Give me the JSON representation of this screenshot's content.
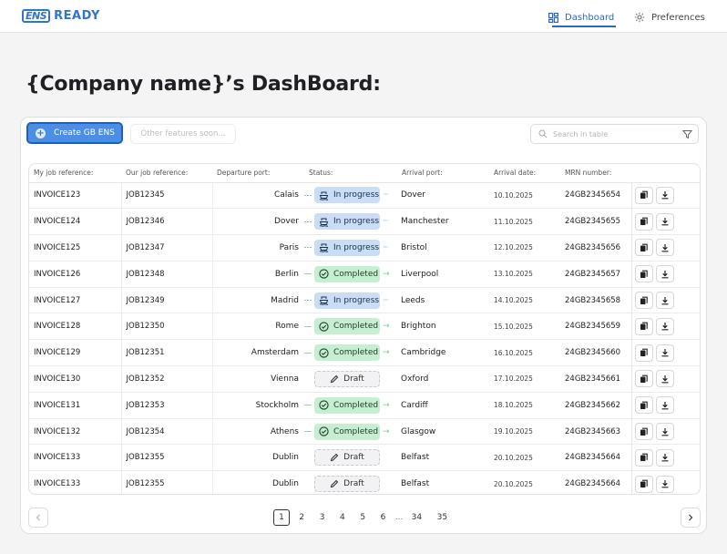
{
  "brand": {
    "mark": "ENS",
    "name": "READY"
  },
  "nav": {
    "dashboard": "Dashboard",
    "preferences": "Preferences"
  },
  "page_title": "{Company name}’s DashBoard:",
  "toolbar": {
    "create_label": "Create GB ENS",
    "soon_label": "Other features soon...",
    "search_placeholder": "Search in table"
  },
  "table": {
    "columns": [
      "My job reference:",
      "Our job reference:",
      "Departure port:",
      "Status:",
      "Arrival port:",
      "Arrival date:",
      "MRN number:"
    ],
    "rows": [
      {
        "my_ref": "INVOICE123",
        "our_ref": "JOB12345",
        "departure": "Calais",
        "status": "In progress",
        "status_type": "progress",
        "arrival": "Dover",
        "date": "10.10.2025",
        "mrn": "24GB2345654"
      },
      {
        "my_ref": "INVOICE124",
        "our_ref": "JOB12346",
        "departure": "Dover",
        "status": "In progress",
        "status_type": "progress",
        "arrival": "Manchester",
        "date": "11.10.2025",
        "mrn": "24GB2345655"
      },
      {
        "my_ref": "INVOICE125",
        "our_ref": "JOB12347",
        "departure": "Paris",
        "status": "In progress",
        "status_type": "progress",
        "arrival": "Bristol",
        "date": "12.10.2025",
        "mrn": "24GB2345656"
      },
      {
        "my_ref": "INVOICE126",
        "our_ref": "JOB12348",
        "departure": "Berlin",
        "status": "Completed",
        "status_type": "completed",
        "arrival": "Liverpool",
        "date": "13.10.2025",
        "mrn": "24GB2345657"
      },
      {
        "my_ref": "INVOICE127",
        "our_ref": "JOB12349",
        "departure": "Madrid",
        "status": "In progress",
        "status_type": "progress",
        "arrival": "Leeds",
        "date": "14.10.2025",
        "mrn": "24GB2345658"
      },
      {
        "my_ref": "INVOICE128",
        "our_ref": "JOB12350",
        "departure": "Rome",
        "status": "Completed",
        "status_type": "completed",
        "arrival": "Brighton",
        "date": "15.10.2025",
        "mrn": "24GB2345659"
      },
      {
        "my_ref": "INVOICE129",
        "our_ref": "JOB12351",
        "departure": "Amsterdam",
        "status": "Completed",
        "status_type": "completed",
        "arrival": "Cambridge",
        "date": "16.10.2025",
        "mrn": "24GB2345660"
      },
      {
        "my_ref": "INVOICE130",
        "our_ref": "JOB12352",
        "departure": "Vienna",
        "status": "Draft",
        "status_type": "draft",
        "arrival": "Oxford",
        "date": "17.10.2025",
        "mrn": "24GB2345661"
      },
      {
        "my_ref": "INVOICE131",
        "our_ref": "JOB12353",
        "departure": "Stockholm",
        "status": "Completed",
        "status_type": "completed",
        "arrival": "Cardiff",
        "date": "18.10.2025",
        "mrn": "24GB2345662"
      },
      {
        "my_ref": "INVOICE132",
        "our_ref": "JOB12354",
        "departure": "Athens",
        "status": "Completed",
        "status_type": "completed",
        "arrival": "Glasgow",
        "date": "19.10.2025",
        "mrn": "24GB2345663"
      },
      {
        "my_ref": "INVOICE133",
        "our_ref": "JOB12355",
        "departure": "Dublin",
        "status": "Draft",
        "status_type": "draft",
        "arrival": "Belfast",
        "date": "20.10.2025",
        "mrn": "24GB2345664"
      },
      {
        "my_ref": "INVOICE133",
        "our_ref": "JOB12355",
        "departure": "Dublin",
        "status": "Draft",
        "status_type": "draft",
        "arrival": "Belfast",
        "date": "20.10.2025",
        "mrn": "24GB2345664"
      }
    ]
  },
  "pagination": {
    "pages": [
      "1",
      "2",
      "3",
      "4",
      "5",
      "6"
    ],
    "ellipsis": "...",
    "tail_pages": [
      "34",
      "35"
    ],
    "current": "1"
  },
  "icons": {
    "dashboard": "grid-icon",
    "preferences": "gear-icon",
    "create": "plus-circle-icon",
    "search": "search-icon",
    "filter": "filter-icon",
    "progress": "ship-icon",
    "completed": "check-circle-icon",
    "draft": "pencil-icon",
    "copy": "copy-icon",
    "download": "download-icon"
  },
  "colors": {
    "accent": "#2f74d4",
    "progress_bg": "#c9ddf6",
    "completed_bg": "#c6efd2",
    "draft_bg": "#f2f2f4"
  }
}
